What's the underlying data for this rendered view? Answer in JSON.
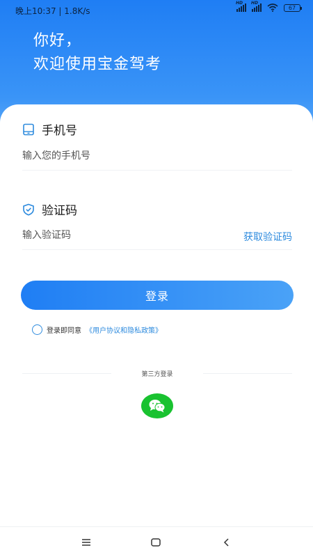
{
  "status_bar": {
    "time_speed": "晚上10:37 | 1.8K/s",
    "signal_tag": "HD",
    "battery": "67"
  },
  "header": {
    "greeting_line1": "你好，",
    "greeting_line2": "欢迎使用宝金驾考"
  },
  "phone": {
    "label": "手机号",
    "placeholder": "输入您的手机号",
    "icon": "phone-icon"
  },
  "code": {
    "label": "验证码",
    "placeholder": "输入验证码",
    "get_code": "获取验证码",
    "icon": "shield-icon"
  },
  "login_button": "登录",
  "agreement": {
    "prefix": "登录即同意",
    "link": "《用户协议和隐私政策》",
    "checked": false
  },
  "third_party": {
    "title": "第三方登录",
    "wechat_icon": "wechat-icon"
  },
  "colors": {
    "accent": "#2e8bde",
    "header_start": "#1f7ef4",
    "wechat": "#19c230"
  },
  "nav": {
    "menu_icon": "menu-icon",
    "home_icon": "home-icon",
    "back_icon": "back-icon"
  }
}
